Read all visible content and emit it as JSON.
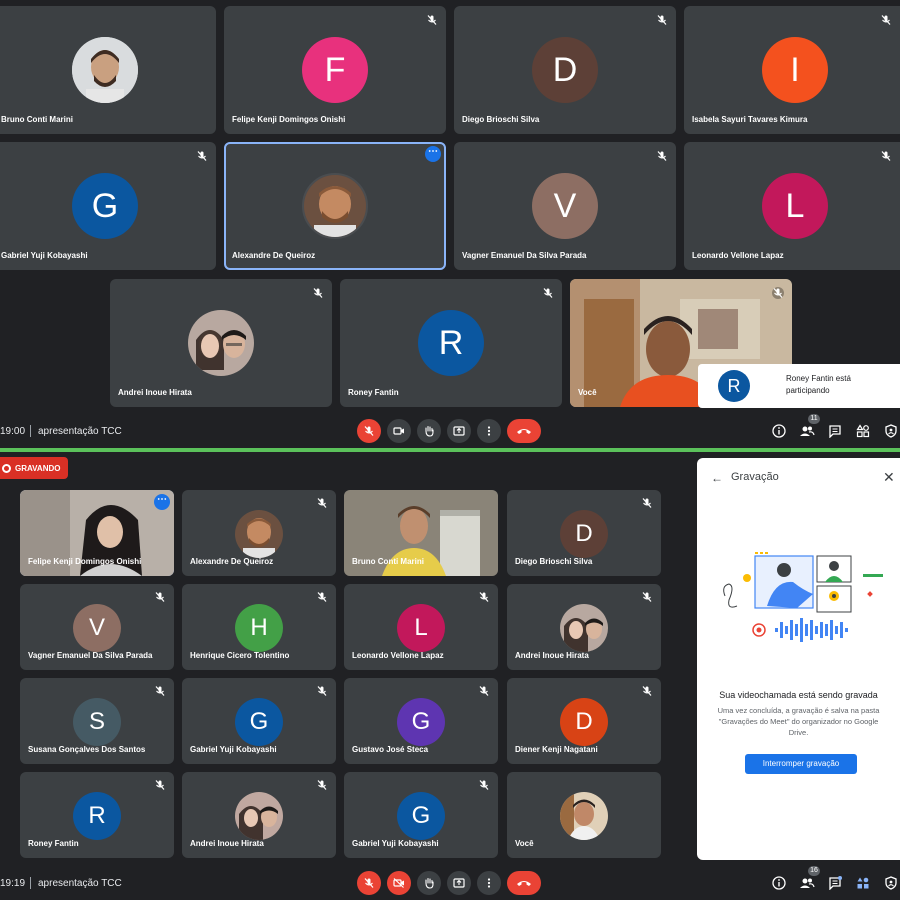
{
  "top": {
    "participants": [
      {
        "name": "Bruno Conti Marini"
      },
      {
        "name": "Felipe Kenji Domingos Onishi",
        "initial": "F",
        "color": "#e8317d"
      },
      {
        "name": "Diego Brioschi Silva",
        "initial": "D",
        "color": "#5d4037"
      },
      {
        "name": "Isabela Sayuri Tavares Kimura",
        "initial": "I",
        "color": "#f4511e"
      },
      {
        "name": "Gabriel Yuji Kobayashi",
        "initial": "G",
        "color": "#0b57a0"
      },
      {
        "name": "Alexandre De Queiroz"
      },
      {
        "name": "Vagner Emanuel Da Silva Parada",
        "initial": "V",
        "color": "#8d6e63"
      },
      {
        "name": "Leonardo Vellone Lapaz",
        "initial": "L",
        "color": "#c2185b"
      },
      {
        "name": "Andrei Inoue Hirata"
      },
      {
        "name": "Roney Fantin",
        "initial": "R",
        "color": "#0b57a0"
      },
      {
        "name": "Você"
      }
    ],
    "toast": {
      "initial": "R",
      "line1": "Roney Fantin está",
      "line2": "participando"
    },
    "bar": {
      "time": "19:00",
      "meeting": "apresentação TCC",
      "people_count": "11"
    }
  },
  "bottom": {
    "recording_label": "GRAVANDO",
    "participants": [
      {
        "name": "Felipe Kenji Domingos Onishi"
      },
      {
        "name": "Alexandre De Queiroz"
      },
      {
        "name": "Bruno Conti Marini"
      },
      {
        "name": "Diego Brioschi Silva",
        "initial": "D",
        "color": "#5d4037"
      },
      {
        "name": "Vagner Emanuel Da Silva Parada",
        "initial": "V",
        "color": "#8d6e63"
      },
      {
        "name": "Henrique Cicero Tolentino",
        "initial": "H",
        "color": "#43a047"
      },
      {
        "name": "Leonardo Vellone Lapaz",
        "initial": "L",
        "color": "#c2185b"
      },
      {
        "name": "Andrei Inoue Hirata"
      },
      {
        "name": "Susana Gonçalves Dos Santos",
        "initial": "S",
        "color": "#455a64"
      },
      {
        "name": "Gabriel Yuji Kobayashi",
        "initial": "G",
        "color": "#0b57a0"
      },
      {
        "name": "Gustavo José Steca",
        "initial": "G",
        "color": "#5e35b1"
      },
      {
        "name": "Diener Kenji Nagatani",
        "initial": "D",
        "color": "#d84315"
      },
      {
        "name": "Roney Fantin",
        "initial": "R",
        "color": "#0b57a0"
      },
      {
        "name": "Andrei Inoue Hirata"
      },
      {
        "name": "Gabriel Yuji Kobayashi",
        "initial": "G",
        "color": "#0b57a0"
      },
      {
        "name": "Você"
      }
    ],
    "panel": {
      "title": "Gravação",
      "heading": "Sua videochamada está sendo gravada",
      "text": "Uma vez concluída, a gravação é salva na pasta \"Gravações do Meet\" do organizador no Google Drive.",
      "button": "Interromper gravação"
    },
    "bar": {
      "time": "19:19",
      "meeting": "apresentação TCC",
      "people_count": "16"
    }
  },
  "colors": {
    "accent": "#1a73e8",
    "danger": "#ea4335",
    "tile": "#3c4043",
    "background": "#202124",
    "divider": "#5bc25b"
  },
  "icons": [
    "mic-off-icon",
    "camera-icon",
    "camera-off-icon",
    "raise-hand-icon",
    "present-icon",
    "more-options-icon",
    "end-call-icon",
    "info-icon",
    "people-icon",
    "chat-icon",
    "activities-icon",
    "host-controls-icon",
    "back-arrow-icon",
    "close-icon"
  ]
}
